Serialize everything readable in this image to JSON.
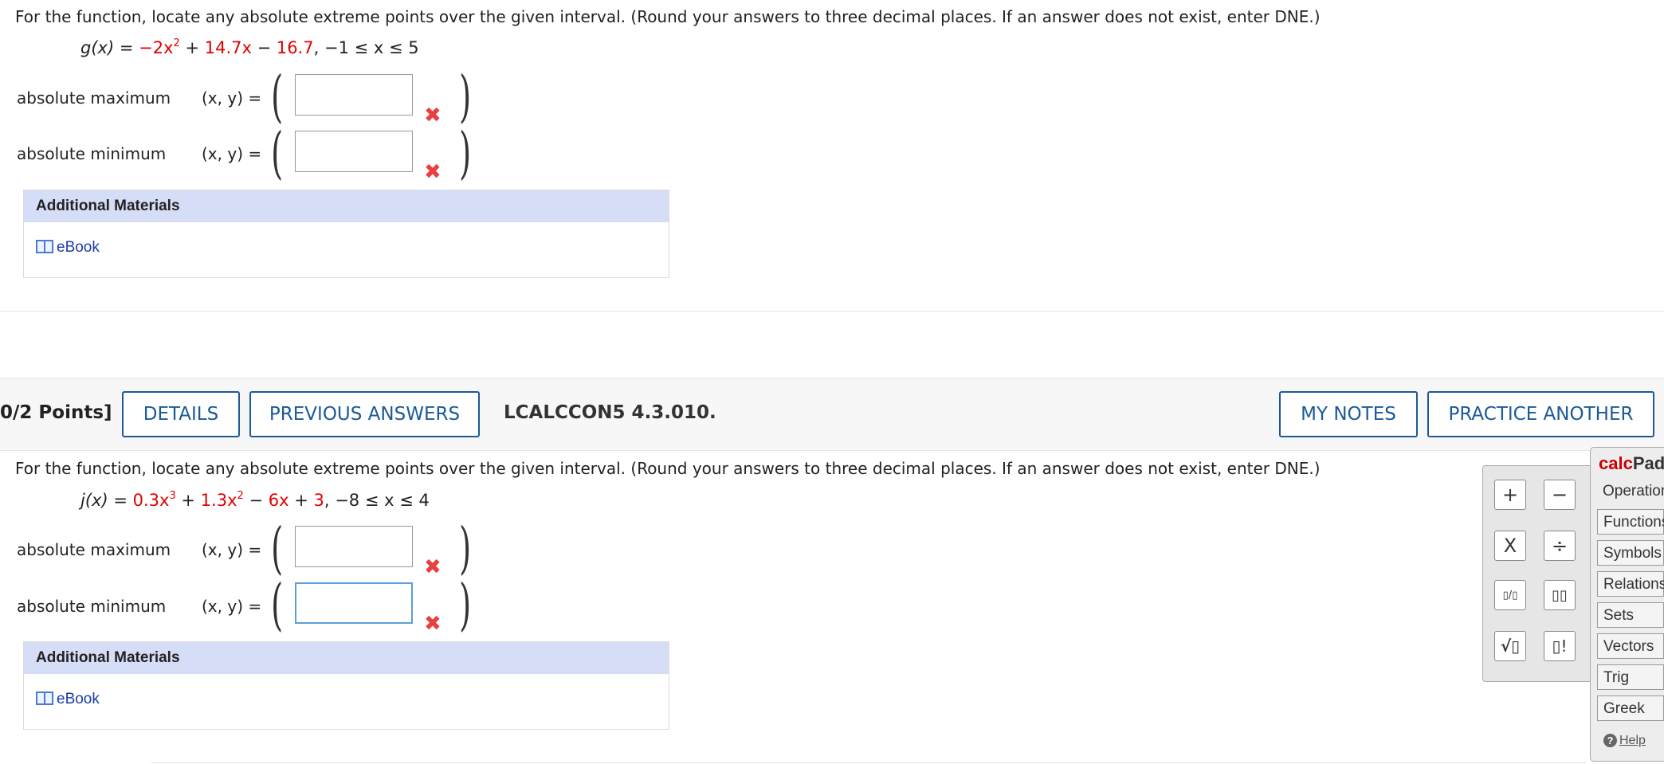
{
  "q1": {
    "instructions": "For the function, locate any absolute extreme points over the given interval. (Round your answers to three decimal places. If an answer does not exist, enter DNE.)",
    "function": {
      "name": "g(x)",
      "equals": " = ",
      "t1": "−2x",
      "t1_exp": "2",
      "op1": " + ",
      "t2": "14.7x",
      "op2": " − ",
      "t3": "16.7",
      "interval": ",  −1 ≤ x ≤ 5"
    },
    "max_label": "absolute maximum",
    "min_label": "absolute minimum",
    "xy_label": "(x, y) =",
    "max_value": "",
    "min_value": "",
    "additional_materials": "Additional Materials",
    "ebook": "eBook"
  },
  "q2": {
    "points": "0/2 Points]",
    "details": "DETAILS",
    "previous_answers": "PREVIOUS ANSWERS",
    "code": "LCALCCON5 4.3.010.",
    "my_notes": "MY NOTES",
    "practice_another": "PRACTICE ANOTHER",
    "instructions": "For the function, locate any absolute extreme points over the given interval. (Round your answers to three decimal places. If an answer does not exist, enter DNE.)",
    "function": {
      "name": "j(x)",
      "equals": " = ",
      "t1": "0.3x",
      "t1_exp": "3",
      "op1": " + ",
      "t2": "1.3x",
      "t2_exp": "2",
      "op2": " − ",
      "t3": "6x",
      "op3": " + ",
      "t4": "3",
      "interval": ",  −8 ≤ x ≤ 4"
    },
    "max_label": "absolute maximum",
    "min_label": "absolute minimum",
    "xy_label": "(x, y) =",
    "max_value": "",
    "min_value": "",
    "additional_materials": "Additional Materials",
    "ebook": "eBook"
  },
  "incorrect_mark": "✖",
  "calcpad": {
    "title_a": "calc",
    "title_b": "Pad",
    "categories": [
      "Operations",
      "Functions",
      "Symbols",
      "Relations",
      "Sets",
      "Vectors",
      "Trig",
      "Greek"
    ],
    "help": "Help",
    "keys": [
      "+",
      "−",
      "X",
      "÷",
      "▯/▯",
      "▯▯",
      "√▯",
      "▯!"
    ]
  },
  "colors": {
    "accent": "#1b5a97",
    "highlight_term": "#e00000",
    "incorrect": "#e84040",
    "materials_header": "#d6ddf7",
    "link": "#1a3da8",
    "calcpad_brand": "#cc0000"
  }
}
